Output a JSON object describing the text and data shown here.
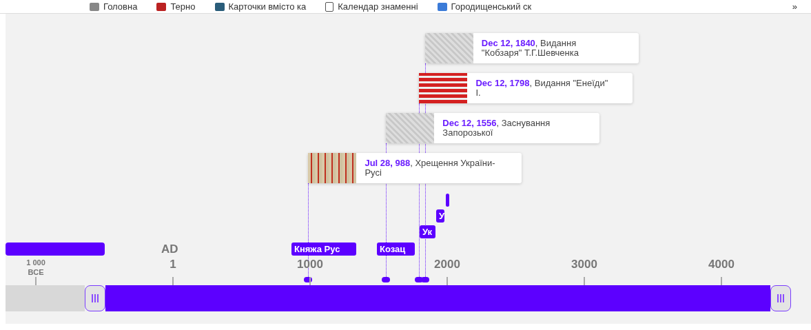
{
  "bookmarks": [
    {
      "label": "Головна"
    },
    {
      "label": "Терно"
    },
    {
      "label": "Карточки вмісто ка"
    },
    {
      "label": "Календар знаменні"
    },
    {
      "label": "Городищенський ск"
    }
  ],
  "bookmarks_more": "»",
  "events": [
    {
      "date": "Dec 12, 1840",
      "title": ", Видання \"Кобзаря\" Т.Г.Шевченка"
    },
    {
      "date": "Dec 12, 1798",
      "title": ", Видання \"Енеїди\" І."
    },
    {
      "date": "Dec 12, 1556",
      "title": ", Заснування Запорозької"
    },
    {
      "date": "Jul 28, 988",
      "title": ", Хрещення України-Русі"
    }
  ],
  "eras": [
    {
      "kind": "blank"
    },
    {
      "kind": "labeled",
      "label": "Княжа Рус"
    },
    {
      "kind": "labeled",
      "label": "Козац"
    },
    {
      "kind": "labeled",
      "label": "Ук"
    },
    {
      "kind": "labeled",
      "label": "У"
    },
    {
      "kind": "blank"
    }
  ],
  "era_label": "AD",
  "ticks": [
    {
      "label": "1 000",
      "sub": "BCE"
    },
    {
      "label": "1"
    },
    {
      "label": "1000"
    },
    {
      "label": "2000"
    },
    {
      "label": "3000"
    },
    {
      "label": "4000"
    }
  ]
}
